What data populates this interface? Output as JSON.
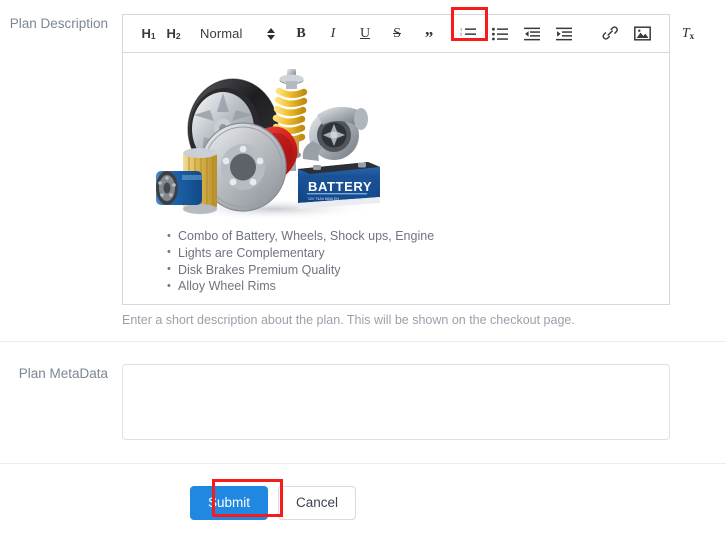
{
  "form": {
    "description_row": {
      "label": "Plan Description",
      "help_text": "Enter a short description about the plan. This will be shown on the checkout page."
    },
    "metadata_row": {
      "label": "Plan MetaData",
      "value": "",
      "placeholder": ""
    }
  },
  "editor": {
    "toolbar": {
      "heading1": "H",
      "heading1_sub": "1",
      "heading2": "H",
      "heading2_sub": "2",
      "size_value": "Normal",
      "bold": "B",
      "italic": "I",
      "underline": "U",
      "strike": "S",
      "blockquote": "”",
      "clear_format": "T",
      "clear_format_sub": "x",
      "icons": {
        "ordered_list": "ordered-list-icon",
        "bullet_list": "bullet-list-icon",
        "outdent": "outdent-icon",
        "indent": "indent-icon",
        "link": "link-icon",
        "image": "image-icon"
      }
    },
    "content": {
      "image_alt": "Auto parts: alloy wheel with tire, brake disc, red brake caliper, coil-over shock absorber, turbocharger, oil filters and a blue car battery",
      "image_label": "BATTERY",
      "bullets": [
        "Combo of Battery, Wheels, Shock ups, Engine",
        "Lights are Complementary",
        "Disk Brakes Premium Quality",
        "Alloy Wheel Rims"
      ]
    }
  },
  "actions": {
    "submit_label": "Submit",
    "cancel_label": "Cancel"
  },
  "colors": {
    "primary_button": "#2088e0",
    "highlight_outline": "#f71b1b",
    "label_text": "#7b8794",
    "help_text": "#9aa0ab",
    "border": "#d6d6dc"
  }
}
